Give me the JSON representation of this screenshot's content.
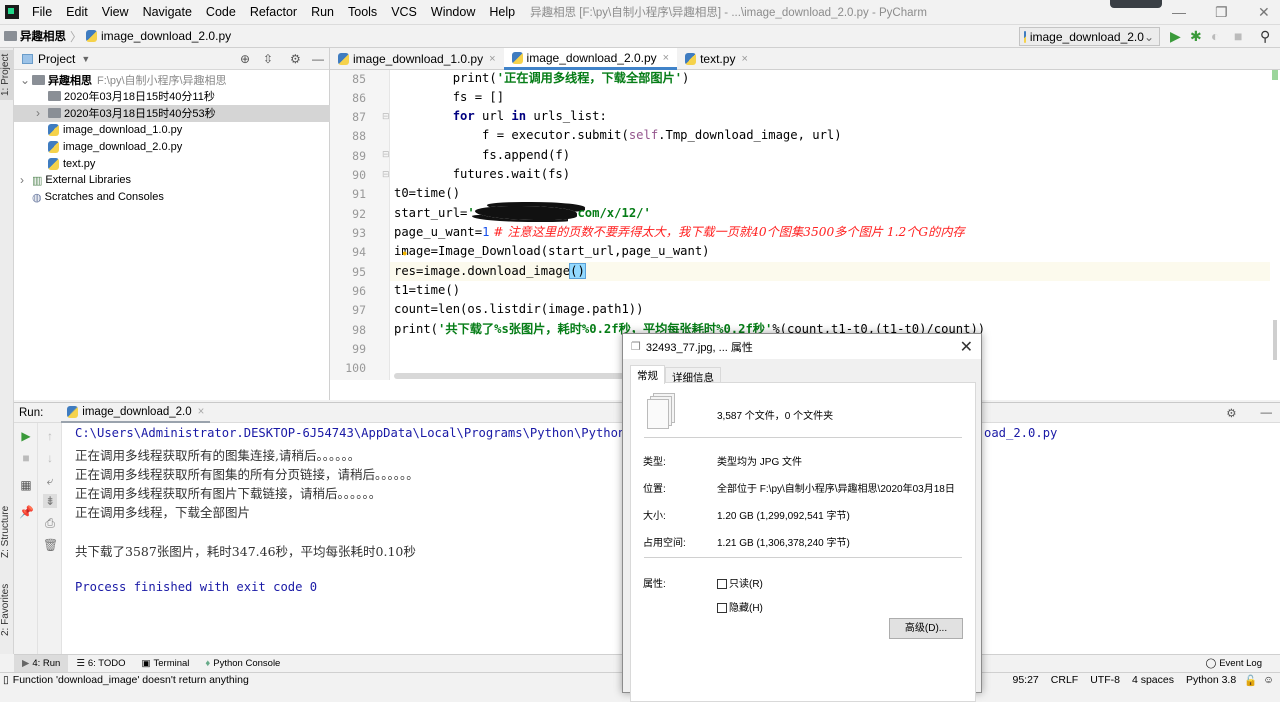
{
  "window": {
    "title": "异趣相思 [F:\\py\\自制小程序\\异趣相思] - ...\\image_download_2.0.py - PyCharm",
    "menus": [
      "File",
      "Edit",
      "View",
      "Navigate",
      "Code",
      "Refactor",
      "Run",
      "Tools",
      "VCS",
      "Window",
      "Help"
    ]
  },
  "navbar": {
    "crumbs": [
      "异趣相思",
      "image_download_2.0.py"
    ]
  },
  "toolbar": {
    "run_config": "image_download_2.0"
  },
  "left_stripe": {
    "project": "1: Project",
    "structure": "Z: Structure",
    "favorites": "2: Favorites"
  },
  "project": {
    "title": "Project",
    "tree": [
      {
        "label": "异趣相思",
        "extra": "F:\\py\\自制小程序\\异趣相思",
        "type": "folder",
        "expanded": true
      },
      {
        "label": "2020年03月18日15时40分11秒",
        "type": "folder"
      },
      {
        "label": "2020年03月18日15时40分53秒",
        "type": "folder",
        "selected": true
      },
      {
        "label": "image_download_1.0.py",
        "type": "py"
      },
      {
        "label": "image_download_2.0.py",
        "type": "py"
      },
      {
        "label": "text.py",
        "type": "py"
      },
      {
        "label": "External Libraries",
        "type": "lib"
      },
      {
        "label": "Scratches and Consoles",
        "type": "scratch"
      }
    ]
  },
  "editor": {
    "tabs": [
      {
        "label": "image_download_1.0.py"
      },
      {
        "label": "image_download_2.0.py",
        "active": true
      },
      {
        "label": "text.py"
      }
    ],
    "lines": [
      {
        "n": "85",
        "tokens": [
          [
            "        print(",
            ""
          ],
          [
            "'正在调用多线程，下载全部图片'",
            "str"
          ],
          [
            ")",
            ""
          ]
        ]
      },
      {
        "n": "86",
        "tokens": [
          [
            "        fs = []",
            ""
          ]
        ]
      },
      {
        "n": "87",
        "tokens": [
          [
            "        ",
            ""
          ],
          [
            "for",
            "kw"
          ],
          [
            " url ",
            ""
          ],
          [
            "in",
            "kw"
          ],
          [
            " urls_list:",
            ""
          ]
        ]
      },
      {
        "n": "88",
        "tokens": [
          [
            "            f = executor.submit(",
            ""
          ],
          [
            "self",
            "self"
          ],
          [
            ".Tmp_download_image, url)",
            ""
          ]
        ]
      },
      {
        "n": "89",
        "tokens": [
          [
            "            fs.append(f)",
            ""
          ]
        ]
      },
      {
        "n": "90",
        "tokens": [
          [
            "        futures.wait(fs)",
            ""
          ]
        ]
      },
      {
        "n": "91",
        "tokens": [
          [
            "t0=time()",
            ""
          ]
        ]
      },
      {
        "n": "92",
        "tokens": [
          [
            "start_url=",
            ""
          ],
          [
            "'",
            "str"
          ],
          [
            "              ",
            "redact"
          ],
          [
            "com/x/12/'",
            "str"
          ]
        ]
      },
      {
        "n": "93",
        "tokens": [
          [
            "page_u_want=",
            ""
          ],
          [
            "1",
            "num"
          ],
          [
            " # 注意这里的页数不要弄得太大，我下载一页就40个图集3500多个图片 1.2个G的内存",
            "cmt"
          ]
        ]
      },
      {
        "n": "94",
        "tokens": [
          [
            "image=Image_Download(start_url,page_u_want)",
            ""
          ]
        ]
      },
      {
        "n": "95",
        "tokens": [
          [
            "res=image.download_image",
            ""
          ],
          [
            "()",
            "brace"
          ]
        ],
        "current": true
      },
      {
        "n": "96",
        "tokens": [
          [
            "t1=time()",
            ""
          ]
        ]
      },
      {
        "n": "97",
        "tokens": [
          [
            "count=len(os.listdir(image.path1))",
            ""
          ]
        ]
      },
      {
        "n": "98",
        "tokens": [
          [
            "print(",
            ""
          ],
          [
            "'共下载了%s张图片，耗时%0.2f秒，平均每张耗时%0.2f秒'",
            "str"
          ],
          [
            "%(count,t1-t0,(t1-t0)/count))",
            ""
          ]
        ]
      },
      {
        "n": "99",
        "tokens": []
      },
      {
        "n": "100",
        "tokens": []
      }
    ]
  },
  "run": {
    "label": "Run:",
    "tab": "image_download_2.0",
    "output": [
      {
        "text": "C:\\Users\\Administrator.DESKTOP-6J54743\\AppData\\Local\\Programs\\Python\\Python",
        "mono": true
      },
      {
        "text": "正在调用多线程获取所有的图集连接,请稍后。。。。。。"
      },
      {
        "text": "正在调用多线程获取所有图集的所有分页链接，请稍后。。。。。。"
      },
      {
        "text": "正在调用多线程获取所有图片下载链接，请稍后。。。。。。"
      },
      {
        "text": "正在调用多线程，下载全部图片"
      },
      {
        "text": ""
      },
      {
        "text": "共下载了3587张图片，耗时347.46秒，平均每张耗时0.10秒"
      },
      {
        "text": ""
      },
      {
        "text": "Process finished with exit code 0",
        "mono": true
      }
    ],
    "output_tail": "oad_2.0.py"
  },
  "bottom_tabs": [
    "4: Run",
    "6: TODO",
    "Terminal",
    "Python Console"
  ],
  "event_log": "Event Log",
  "status": {
    "message": "Function 'download_image' doesn't return anything",
    "position": "95:27",
    "line_sep": "CRLF",
    "encoding": "UTF-8",
    "indent": "4 spaces",
    "interpreter": "Python 3.8"
  },
  "dialog": {
    "title": "32493_77.jpg, ... 属性",
    "tabs": [
      "常规",
      "详细信息"
    ],
    "summary": "3,587 个文件，0 个文件夹",
    "rows": [
      {
        "label": "类型:",
        "value": "类型均为 JPG 文件"
      },
      {
        "label": "位置:",
        "value": "全部位于 F:\\py\\自制小程序\\异趣相思\\2020年03月18日"
      },
      {
        "label": "大小:",
        "value": "1.20 GB (1,299,092,541 字节)"
      },
      {
        "label": "占用空间:",
        "value": "1.21 GB (1,306,378,240 字节)"
      }
    ],
    "attr_label": "属性:",
    "readonly": "只读(R)",
    "hidden": "隐藏(H)",
    "advanced": "高级(D)..."
  },
  "colors": {
    "keyword": "#000080",
    "string": "#067d17",
    "self": "#94558d",
    "number": "#1750eb",
    "comment": "#ff2020",
    "accent": "#4083c9",
    "run_green": "#3a9a3a"
  }
}
